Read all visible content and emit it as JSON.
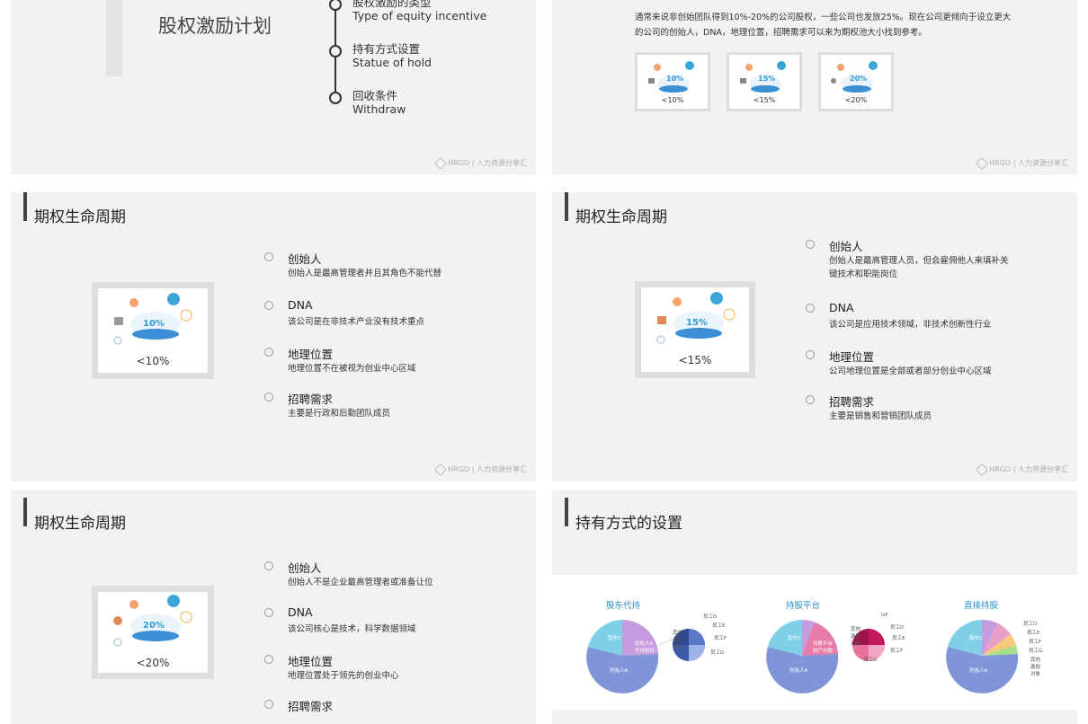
{
  "slide1": {
    "title": "股权激励计划",
    "timeline": [
      {
        "zh": "股权激励的类型",
        "en": "Type of equity incentive"
      },
      {
        "zh": "持有方式设置",
        "en": "Statue of hold"
      },
      {
        "zh": "回收条件",
        "en": "Withdraw"
      }
    ]
  },
  "logo_text": "HRGO | 人力资源分享汇",
  "slide2": {
    "paragraph": "通常来说非创始团队得到10%-20%的公司股权，一些公司也发放25%。现在公司更倾向于设立更大的公司的创始人，DNA，地理位置，招聘需求可以来为期权池大小找到参考。",
    "thumbs": [
      {
        "pct": "10%",
        "caption": "<10%"
      },
      {
        "pct": "15%",
        "caption": "<15%"
      },
      {
        "pct": "20%",
        "caption": "<20%"
      }
    ]
  },
  "slide3": {
    "title": "期权生命周期",
    "pct": "10%",
    "caption": "<10%",
    "items": [
      {
        "h": "创始人",
        "d": "创始人是最高管理者并且其角色不能代替"
      },
      {
        "h": "DNA",
        "d": "该公司是在非技术产业没有技术重点"
      },
      {
        "h": "地理位置",
        "d": "地理位置不在被视为创业中心区域"
      },
      {
        "h": "招聘需求",
        "d": "主要是行政和后勤团队成员"
      }
    ]
  },
  "slide4": {
    "title": "期权生命周期",
    "pct": "15%",
    "caption": "<15%",
    "items": [
      {
        "h": "创始人",
        "d": "创始人是最高管理人员，但会雇佣他人来填补关键技术和职能岗位"
      },
      {
        "h": "DNA",
        "d": "该公司是应用技术领域，非技术创新性行业"
      },
      {
        "h": "地理位置",
        "d": "公司地理位置是全部或者部分创业中心区域"
      },
      {
        "h": "招聘需求",
        "d": "主要是销售和营销团队成员"
      }
    ]
  },
  "slide5": {
    "title": "期权生命周期",
    "pct": "20%",
    "caption": "<20%",
    "items": [
      {
        "h": "创始人",
        "d": "创始人不是企业最高管理者或准备让位"
      },
      {
        "h": "DNA",
        "d": "该公司核心是技术，科学数据领域"
      },
      {
        "h": "地理位置",
        "d": "地理位置处于领先的创业中心"
      },
      {
        "h": "招聘需求",
        "d": ""
      }
    ]
  },
  "slide6": {
    "title": "持有方式的设置",
    "pies": [
      {
        "name": "股东代持",
        "labels": {
          "big": "创始人A",
          "left": "股东C",
          "mid": "创始人A代持股份",
          "pool": "其他激励对象",
          "e1": "员工D",
          "e2": "员工E",
          "e3": "员工F",
          "e4": "员工G"
        }
      },
      {
        "name": "持股平台",
        "labels": {
          "big": "创始人A",
          "left": "股东C",
          "mid": "持股平台财产份额",
          "pool": "其他激励对象",
          "gp": "GP",
          "e1": "员工D",
          "e2": "员工E",
          "e3": "员工F",
          "e4": "员工G"
        }
      },
      {
        "name": "直接持股",
        "labels": {
          "big": "创始人A",
          "left": "股东C",
          "e1": "员工D",
          "e2": "员工E",
          "e3": "员工F",
          "e4": "员工G",
          "pool": "其他激励对象"
        }
      }
    ]
  },
  "colors": {
    "accent": "#2f9ad8",
    "pie_blue": "#7f95d8",
    "pie_cyan": "#7fd0e6",
    "pie_purple": "#c79be0",
    "pie_pink": "#e8709a",
    "pie_navy": "#3b5aa8"
  }
}
